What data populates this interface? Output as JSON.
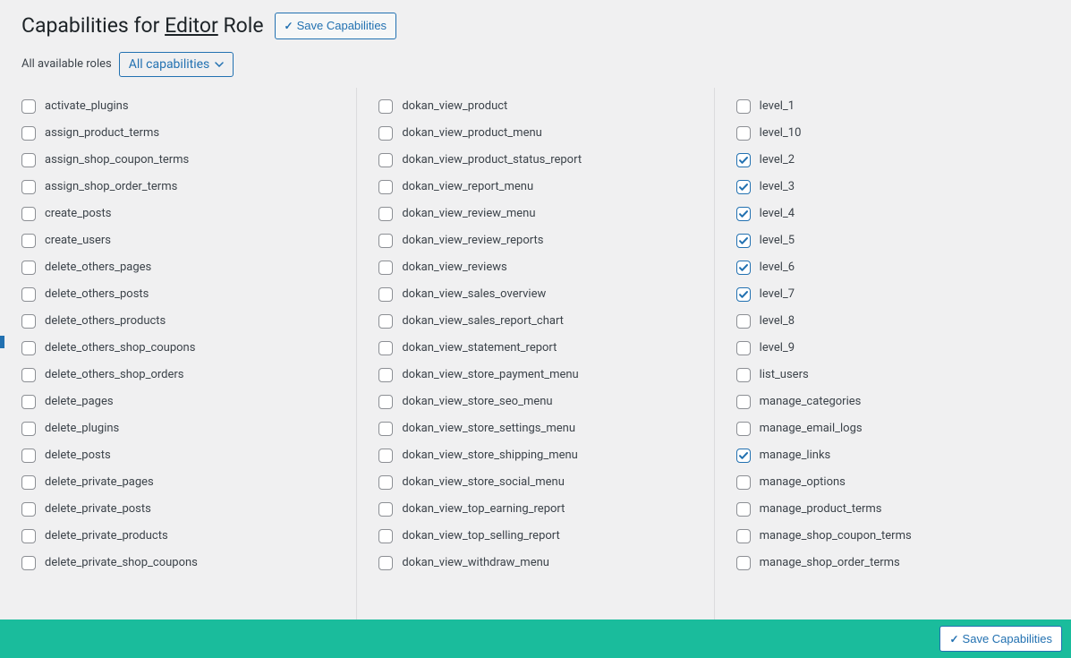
{
  "header": {
    "title_prefix": "Capabilities for ",
    "role_name": "Editor",
    "title_suffix": " Role",
    "save_button": "Save Capabilities"
  },
  "filter": {
    "label": "All available roles",
    "dropdown_selected": "All capabilities"
  },
  "bottom": {
    "save_button": "Save Capabilities"
  },
  "columns": [
    {
      "items": [
        {
          "label": "activate_plugins",
          "checked": false
        },
        {
          "label": "assign_product_terms",
          "checked": false
        },
        {
          "label": "assign_shop_coupon_terms",
          "checked": false
        },
        {
          "label": "assign_shop_order_terms",
          "checked": false
        },
        {
          "label": "create_posts",
          "checked": false
        },
        {
          "label": "create_users",
          "checked": false
        },
        {
          "label": "delete_others_pages",
          "checked": false
        },
        {
          "label": "delete_others_posts",
          "checked": false
        },
        {
          "label": "delete_others_products",
          "checked": false
        },
        {
          "label": "delete_others_shop_coupons",
          "checked": false
        },
        {
          "label": "delete_others_shop_orders",
          "checked": false
        },
        {
          "label": "delete_pages",
          "checked": false
        },
        {
          "label": "delete_plugins",
          "checked": false
        },
        {
          "label": "delete_posts",
          "checked": false
        },
        {
          "label": "delete_private_pages",
          "checked": false
        },
        {
          "label": "delete_private_posts",
          "checked": false
        },
        {
          "label": "delete_private_products",
          "checked": false
        },
        {
          "label": "delete_private_shop_coupons",
          "checked": false
        }
      ]
    },
    {
      "items": [
        {
          "label": "dokan_view_product",
          "checked": false
        },
        {
          "label": "dokan_view_product_menu",
          "checked": false
        },
        {
          "label": "dokan_view_product_status_report",
          "checked": false
        },
        {
          "label": "dokan_view_report_menu",
          "checked": false
        },
        {
          "label": "dokan_view_review_menu",
          "checked": false
        },
        {
          "label": "dokan_view_review_reports",
          "checked": false
        },
        {
          "label": "dokan_view_reviews",
          "checked": false
        },
        {
          "label": "dokan_view_sales_overview",
          "checked": false
        },
        {
          "label": "dokan_view_sales_report_chart",
          "checked": false
        },
        {
          "label": "dokan_view_statement_report",
          "checked": false
        },
        {
          "label": "dokan_view_store_payment_menu",
          "checked": false
        },
        {
          "label": "dokan_view_store_seo_menu",
          "checked": false
        },
        {
          "label": "dokan_view_store_settings_menu",
          "checked": false
        },
        {
          "label": "dokan_view_store_shipping_menu",
          "checked": false
        },
        {
          "label": "dokan_view_store_social_menu",
          "checked": false
        },
        {
          "label": "dokan_view_top_earning_report",
          "checked": false
        },
        {
          "label": "dokan_view_top_selling_report",
          "checked": false
        },
        {
          "label": "dokan_view_withdraw_menu",
          "checked": false
        }
      ]
    },
    {
      "items": [
        {
          "label": "level_1",
          "checked": false
        },
        {
          "label": "level_10",
          "checked": false
        },
        {
          "label": "level_2",
          "checked": true
        },
        {
          "label": "level_3",
          "checked": true
        },
        {
          "label": "level_4",
          "checked": true
        },
        {
          "label": "level_5",
          "checked": true
        },
        {
          "label": "level_6",
          "checked": true
        },
        {
          "label": "level_7",
          "checked": true
        },
        {
          "label": "level_8",
          "checked": false
        },
        {
          "label": "level_9",
          "checked": false
        },
        {
          "label": "list_users",
          "checked": false
        },
        {
          "label": "manage_categories",
          "checked": false
        },
        {
          "label": "manage_email_logs",
          "checked": false
        },
        {
          "label": "manage_links",
          "checked": true
        },
        {
          "label": "manage_options",
          "checked": false
        },
        {
          "label": "manage_product_terms",
          "checked": false
        },
        {
          "label": "manage_shop_coupon_terms",
          "checked": false
        },
        {
          "label": "manage_shop_order_terms",
          "checked": false
        }
      ]
    }
  ]
}
